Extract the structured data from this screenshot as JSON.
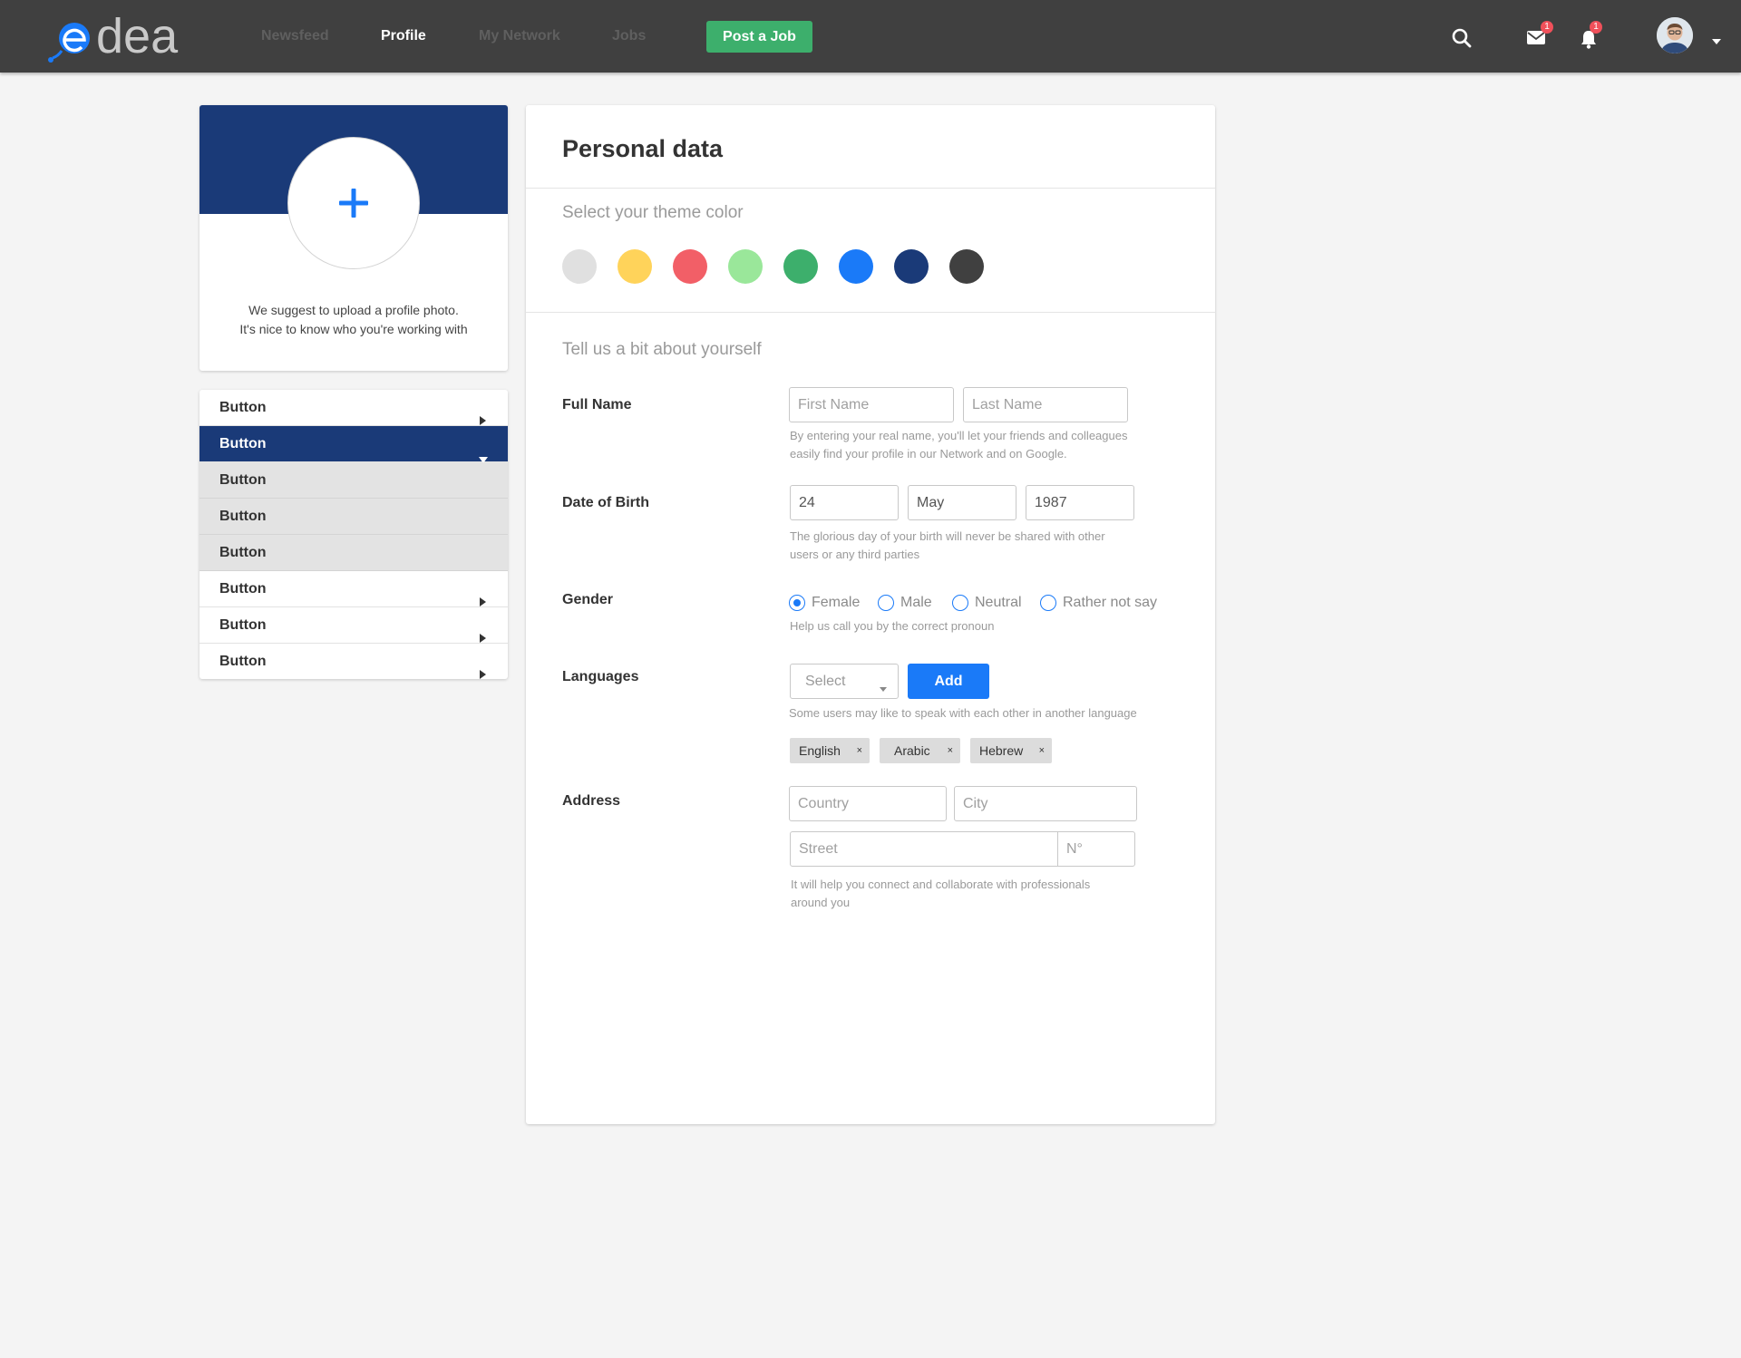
{
  "brand": {
    "logo_text": "edea",
    "colors": {
      "topbar": "#404040",
      "accent": "#1a7af8",
      "primary": "#1a3a78",
      "success": "#3daf6c",
      "badge": "#f0505a"
    }
  },
  "nav": {
    "items": [
      {
        "label": "Newsfeed",
        "active": false
      },
      {
        "label": "Profile",
        "active": true
      },
      {
        "label": "My Network",
        "active": false
      },
      {
        "label": "Jobs",
        "active": false
      }
    ],
    "post_job_label": "Post a Job"
  },
  "header_icons": {
    "search_icon": "search-icon",
    "mail_icon": "mail-icon",
    "mail_badge": "1",
    "bell_icon": "bell-icon",
    "bell_badge": "1",
    "avatar_icon": "user-avatar",
    "caret_icon": "caret-down-icon"
  },
  "profile_card": {
    "upload_icon": "plus-icon",
    "hint_line1": "We suggest to upload a profile photo.",
    "hint_line2": "It's nice to know who you're working with"
  },
  "menu": {
    "items": [
      {
        "label": "Button",
        "state": "collapsed"
      },
      {
        "label": "Button",
        "state": "expanded"
      },
      {
        "label": "Button",
        "state": "sub"
      },
      {
        "label": "Button",
        "state": "sub"
      },
      {
        "label": "Button",
        "state": "sub"
      },
      {
        "label": "Button",
        "state": "collapsed"
      },
      {
        "label": "Button",
        "state": "collapsed"
      },
      {
        "label": "Button",
        "state": "collapsed"
      }
    ]
  },
  "personal": {
    "title": "Personal data",
    "theme_title": "Select your theme color",
    "theme_colors": [
      "#e0e0e0",
      "#ffd35a",
      "#f25f67",
      "#9ae79a",
      "#3daf6c",
      "#1a7af8",
      "#1a3a78",
      "#404040"
    ],
    "about_title": "Tell us a bit about yourself",
    "full_name": {
      "label": "Full Name",
      "first_placeholder": "First Name",
      "last_placeholder": "Last Name",
      "help_line1": "By entering your real name, you'll let your friends and colleagues",
      "help_line2": "easily find your profile in our Network and on Google."
    },
    "dob": {
      "label": "Date of Birth",
      "day": "24",
      "month": "May",
      "year": "1987",
      "help_line1": "The glorious day of your birth will never be shared with other",
      "help_line2": "users or any third parties"
    },
    "gender": {
      "label": "Gender",
      "options": [
        "Female",
        "Male",
        "Neutral",
        "Rather not say"
      ],
      "selected": "Female",
      "help": "Help us call you by the correct pronoun"
    },
    "languages": {
      "label": "Languages",
      "select_value": "Select",
      "add_label": "Add",
      "help": "Some users may like to speak with each other in another language",
      "chips": [
        "English",
        "Arabic",
        "Hebrew"
      ],
      "remove_icon": "×"
    },
    "address": {
      "label": "Address",
      "country_placeholder": "Country",
      "city_placeholder": "City",
      "street_placeholder": "Street",
      "number_placeholder": "N°",
      "help_line1": "It will help you connect and collaborate with professionals",
      "help_line2": "around you"
    }
  }
}
